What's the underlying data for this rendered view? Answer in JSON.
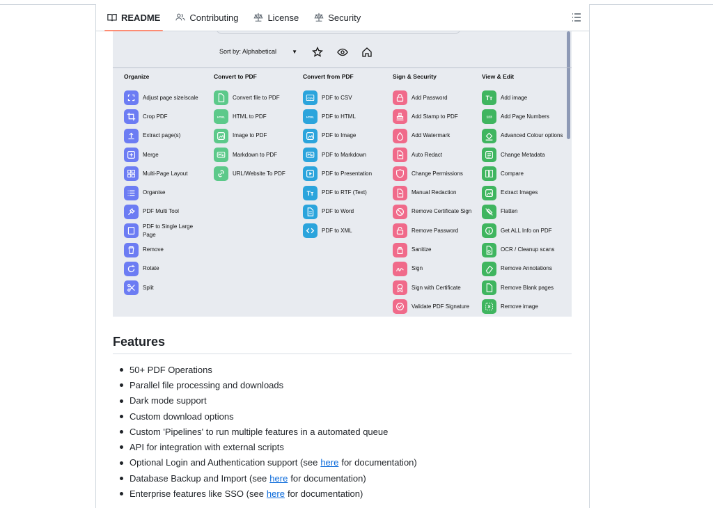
{
  "tabs": [
    {
      "label": "README",
      "icon": "book-icon"
    },
    {
      "label": "Contributing",
      "icon": "people-icon"
    },
    {
      "label": "License",
      "icon": "law-icon"
    },
    {
      "label": "Security",
      "icon": "law-icon"
    }
  ],
  "outline_icon": "list-icon",
  "app": {
    "sort_label": "Sort by: Alphabetical",
    "columns": [
      {
        "heading": "Organize",
        "color": "#6c7cf3",
        "items": [
          {
            "label": "Adjust page size/scale",
            "icon": "resize-icon"
          },
          {
            "label": "Crop PDF",
            "icon": "crop-icon"
          },
          {
            "label": "Extract page(s)",
            "icon": "upload-icon"
          },
          {
            "label": "Merge",
            "icon": "merge-icon"
          },
          {
            "label": "Multi-Page Layout",
            "icon": "grid-icon"
          },
          {
            "label": "Organise",
            "icon": "list-icon"
          },
          {
            "label": "PDF Multi Tool",
            "icon": "tools-icon"
          },
          {
            "label": "PDF to Single Large Page",
            "icon": "page-icon"
          },
          {
            "label": "Remove",
            "icon": "trash-icon"
          },
          {
            "label": "Rotate",
            "icon": "rotate-icon"
          },
          {
            "label": "Split",
            "icon": "scissors-icon"
          }
        ]
      },
      {
        "heading": "Convert to PDF",
        "color": "#5cc98a",
        "items": [
          {
            "label": "Convert file to PDF",
            "icon": "file-icon"
          },
          {
            "label": "HTML to PDF",
            "icon": "html-icon"
          },
          {
            "label": "Image to PDF",
            "icon": "image-icon"
          },
          {
            "label": "Markdown to PDF",
            "icon": "markdown-icon"
          },
          {
            "label": "URL/Website To PDF",
            "icon": "link-icon"
          }
        ]
      },
      {
        "heading": "Convert from PDF",
        "color": "#2ba4dc",
        "items": [
          {
            "label": "PDF to CSV",
            "icon": "csv-icon"
          },
          {
            "label": "PDF to HTML",
            "icon": "html-icon"
          },
          {
            "label": "PDF to Image",
            "icon": "image-icon"
          },
          {
            "label": "PDF to Markdown",
            "icon": "markdown-icon"
          },
          {
            "label": "PDF to Presentation",
            "icon": "presentation-icon"
          },
          {
            "label": "PDF to RTF (Text)",
            "icon": "text-icon"
          },
          {
            "label": "PDF to Word",
            "icon": "word-icon"
          },
          {
            "label": "PDF to XML",
            "icon": "code-icon"
          }
        ]
      },
      {
        "heading": "Sign & Security",
        "color": "#f06a8a",
        "items": [
          {
            "label": "Add Password",
            "icon": "lock-icon"
          },
          {
            "label": "Add Stamp to PDF",
            "icon": "stamp-icon"
          },
          {
            "label": "Add Watermark",
            "icon": "drop-icon"
          },
          {
            "label": "Auto Redact",
            "icon": "redact-icon"
          },
          {
            "label": "Change Permissions",
            "icon": "shield-icon"
          },
          {
            "label": "Manual Redaction",
            "icon": "redact-icon"
          },
          {
            "label": "Remove Certificate Sign",
            "icon": "no-sign-icon"
          },
          {
            "label": "Remove Password",
            "icon": "unlock-icon"
          },
          {
            "label": "Sanitize",
            "icon": "sanitize-icon"
          },
          {
            "label": "Sign",
            "icon": "signature-icon"
          },
          {
            "label": "Sign with Certificate",
            "icon": "certificate-icon"
          },
          {
            "label": "Validate PDF Signature",
            "icon": "check-icon"
          }
        ]
      },
      {
        "heading": "View & Edit",
        "color": "#3fb55f",
        "items": [
          {
            "label": "Add image",
            "icon": "text-icon"
          },
          {
            "label": "Add Page Numbers",
            "icon": "numbers-icon"
          },
          {
            "label": "Advanced Colour options",
            "icon": "paint-icon"
          },
          {
            "label": "Change Metadata",
            "icon": "metadata-icon"
          },
          {
            "label": "Compare",
            "icon": "compare-icon"
          },
          {
            "label": "Extract Images",
            "icon": "image-icon"
          },
          {
            "label": "Flatten",
            "icon": "flatten-icon"
          },
          {
            "label": "Get ALL Info on PDF",
            "icon": "info-icon"
          },
          {
            "label": "OCR / Cleanup scans",
            "icon": "ocr-icon"
          },
          {
            "label": "Remove Annotations",
            "icon": "eraser-icon"
          },
          {
            "label": "Remove Blank pages",
            "icon": "blank-page-icon"
          },
          {
            "label": "Remove image",
            "icon": "remove-image-icon"
          }
        ]
      }
    ]
  },
  "features": {
    "title": "Features",
    "items": [
      {
        "text": "50+ PDF Operations"
      },
      {
        "text": "Parallel file processing and downloads"
      },
      {
        "text": "Dark mode support"
      },
      {
        "text": "Custom download options"
      },
      {
        "text": "Custom 'Pipelines' to run multiple features in a automated queue"
      },
      {
        "text": "API for integration with external scripts"
      },
      {
        "text": "Optional Login and Authentication support (see",
        "link": "here",
        "after": "for documentation)"
      },
      {
        "text": "Database Backup and Import (see",
        "link": "here",
        "after": "for documentation)"
      },
      {
        "text": "Enterprise features like SSO (see",
        "link": "here",
        "after": "for documentation)"
      }
    ]
  }
}
